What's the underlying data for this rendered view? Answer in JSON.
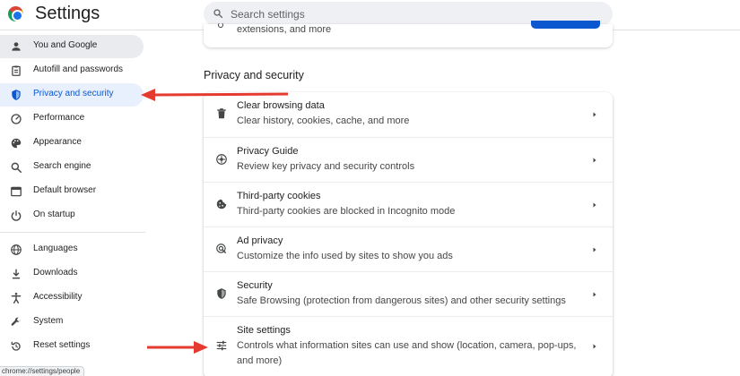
{
  "header": {
    "title": "Settings",
    "search_placeholder": "Search settings"
  },
  "sidebar": {
    "items": [
      {
        "label": "You and Google",
        "icon": "person-icon"
      },
      {
        "label": "Autofill and passwords",
        "icon": "clipboard-icon"
      },
      {
        "label": "Privacy and security",
        "icon": "shield-icon"
      },
      {
        "label": "Performance",
        "icon": "gauge-icon"
      },
      {
        "label": "Appearance",
        "icon": "palette-icon"
      },
      {
        "label": "Search engine",
        "icon": "search-icon"
      },
      {
        "label": "Default browser",
        "icon": "browser-icon"
      },
      {
        "label": "On startup",
        "icon": "power-icon"
      },
      {
        "label": "Languages",
        "icon": "globe-icon"
      },
      {
        "label": "Downloads",
        "icon": "download-icon"
      },
      {
        "label": "Accessibility",
        "icon": "accessibility-icon"
      },
      {
        "label": "System",
        "icon": "wrench-icon"
      },
      {
        "label": "Reset settings",
        "icon": "reset-icon"
      }
    ],
    "active_index": 2,
    "hover_index": 0
  },
  "main": {
    "top_card_text": "extensions, and more",
    "section_title": "Privacy and security",
    "rows": [
      {
        "title": "Clear browsing data",
        "subtitle": "Clear history, cookies, cache, and more",
        "icon": "trash-icon"
      },
      {
        "title": "Privacy Guide",
        "subtitle": "Review key privacy and security controls",
        "icon": "compass-icon"
      },
      {
        "title": "Third-party cookies",
        "subtitle": "Third-party cookies are blocked in Incognito mode",
        "icon": "cookie-icon"
      },
      {
        "title": "Ad privacy",
        "subtitle": "Customize the info used by sites to show you ads",
        "icon": "ad-privacy-icon"
      },
      {
        "title": "Security",
        "subtitle": "Safe Browsing (protection from dangerous sites) and other security settings",
        "icon": "shield-icon"
      },
      {
        "title": "Site settings",
        "subtitle": "Controls what information sites can use and show (location, camera, pop-ups, and more)",
        "icon": "sliders-icon"
      }
    ]
  },
  "status_url": "chrome://settings/people",
  "colors": {
    "accent": "#0b57d0",
    "active_bg": "#e8f0fe",
    "annotation_arrow": "#e53a2f"
  }
}
